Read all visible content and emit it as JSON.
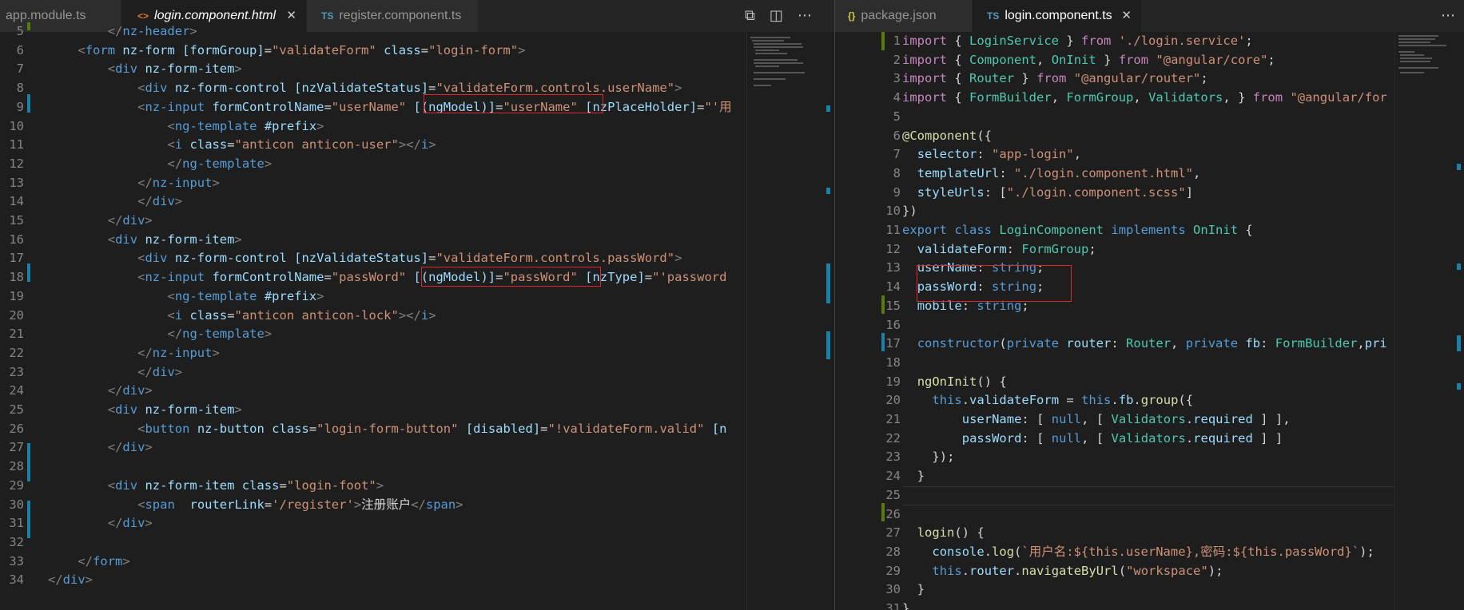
{
  "left_editor": {
    "tabs": [
      {
        "label": "app.module.ts",
        "icon": "TS",
        "active": false
      },
      {
        "label": "login.component.html",
        "icon": "<>",
        "active": true
      },
      {
        "label": "register.component.ts",
        "icon": "TS",
        "active": false
      }
    ],
    "actions": [
      "open-preview-icon",
      "split-editor-icon",
      "more-actions-icon"
    ],
    "lines": [
      {
        "n": "5",
        "code": "        </nz-header>"
      },
      {
        "n": "6",
        "code": "    <form nz-form [formGroup]=\"validateForm\" class=\"login-form\">"
      },
      {
        "n": "7",
        "code": "        <div nz-form-item>"
      },
      {
        "n": "8",
        "code": "            <div nz-form-control [nzValidateStatus]=\"validateForm.controls.userName\">"
      },
      {
        "n": "9",
        "code": "            <nz-input formControlName=\"userName\" [(ngModel)]=\"userName\" [nzPlaceHolder]=\"'用"
      },
      {
        "n": "10",
        "code": "                <ng-template #prefix>"
      },
      {
        "n": "11",
        "code": "                <i class=\"anticon anticon-user\"></i>"
      },
      {
        "n": "12",
        "code": "                </ng-template>"
      },
      {
        "n": "13",
        "code": "            </nz-input>"
      },
      {
        "n": "14",
        "code": "            </div>"
      },
      {
        "n": "15",
        "code": "        </div>"
      },
      {
        "n": "16",
        "code": "        <div nz-form-item>"
      },
      {
        "n": "17",
        "code": "            <div nz-form-control [nzValidateStatus]=\"validateForm.controls.passWord\">"
      },
      {
        "n": "18",
        "code": "            <nz-input formControlName=\"passWord\" [(ngModel)]=\"passWord\" [nzType]=\"'password"
      },
      {
        "n": "19",
        "code": "                <ng-template #prefix>"
      },
      {
        "n": "20",
        "code": "                <i class=\"anticon anticon-lock\"></i>"
      },
      {
        "n": "21",
        "code": "                </ng-template>"
      },
      {
        "n": "22",
        "code": "            </nz-input>"
      },
      {
        "n": "23",
        "code": "            </div>"
      },
      {
        "n": "24",
        "code": "        </div>"
      },
      {
        "n": "25",
        "code": "        <div nz-form-item>"
      },
      {
        "n": "26",
        "code": "            <button nz-button class=\"login-form-button\" [disabled]=\"!validateForm.valid\" [n"
      },
      {
        "n": "27",
        "code": "        </div>"
      },
      {
        "n": "28",
        "code": ""
      },
      {
        "n": "29",
        "code": "        <div nz-form-item class=\"login-foot\">"
      },
      {
        "n": "30",
        "code": "            <span  routerLink='/register'>注册账户</span>"
      },
      {
        "n": "31",
        "code": "        </div>"
      },
      {
        "n": "32",
        "code": ""
      },
      {
        "n": "33",
        "code": "    </form>"
      },
      {
        "n": "34",
        "code": "</div>"
      }
    ]
  },
  "right_editor": {
    "tabs": [
      {
        "label": "package.json",
        "icon": "{}",
        "active": false
      },
      {
        "label": "login.component.ts",
        "icon": "TS",
        "active": true
      }
    ],
    "actions": [
      "more-actions-icon"
    ],
    "lines": [
      {
        "n": "1",
        "code": "import { LoginService } from './login.service';"
      },
      {
        "n": "2",
        "code": "import { Component, OnInit } from \"@angular/core\";"
      },
      {
        "n": "3",
        "code": "import { Router } from \"@angular/router\";"
      },
      {
        "n": "4",
        "code": "import { FormBuilder, FormGroup, Validators, } from \"@angular/for"
      },
      {
        "n": "5",
        "code": ""
      },
      {
        "n": "6",
        "code": "@Component({"
      },
      {
        "n": "7",
        "code": "  selector: \"app-login\","
      },
      {
        "n": "8",
        "code": "  templateUrl: \"./login.component.html\","
      },
      {
        "n": "9",
        "code": "  styleUrls: [\"./login.component.scss\"]"
      },
      {
        "n": "10",
        "code": "})"
      },
      {
        "n": "11",
        "code": "export class LoginComponent implements OnInit {"
      },
      {
        "n": "12",
        "code": "  validateForm: FormGroup;"
      },
      {
        "n": "13",
        "code": "  userName: string;"
      },
      {
        "n": "14",
        "code": "  passWord: string;"
      },
      {
        "n": "15",
        "code": "  mobile: string;"
      },
      {
        "n": "16",
        "code": ""
      },
      {
        "n": "17",
        "code": "  constructor(private router: Router, private fb: FormBuilder,pri"
      },
      {
        "n": "18",
        "code": ""
      },
      {
        "n": "19",
        "code": "  ngOnInit() {"
      },
      {
        "n": "20",
        "code": "    this.validateForm = this.fb.group({"
      },
      {
        "n": "21",
        "code": "        userName: [ null, [ Validators.required ] ],"
      },
      {
        "n": "22",
        "code": "        passWord: [ null, [ Validators.required ] ]"
      },
      {
        "n": "23",
        "code": "    });"
      },
      {
        "n": "24",
        "code": "  }"
      },
      {
        "n": "25",
        "code": ""
      },
      {
        "n": "26",
        "code": ""
      },
      {
        "n": "27",
        "code": "  login() {"
      },
      {
        "n": "28",
        "code": "    console.log(`用户名:${this.userName},密码:${this.passWord}`);"
      },
      {
        "n": "29",
        "code": "    this.router.navigateByUrl(\"workspace\");"
      },
      {
        "n": "30",
        "code": "  }"
      },
      {
        "n": "31",
        "code": "}"
      }
    ]
  },
  "colors": {
    "editor_bg": "#1e1e1e",
    "tab_bg": "#2d2d2d",
    "highlight_box": "#e0272b",
    "git_modified": "#1b81a8",
    "git_added": "#587c0c"
  }
}
